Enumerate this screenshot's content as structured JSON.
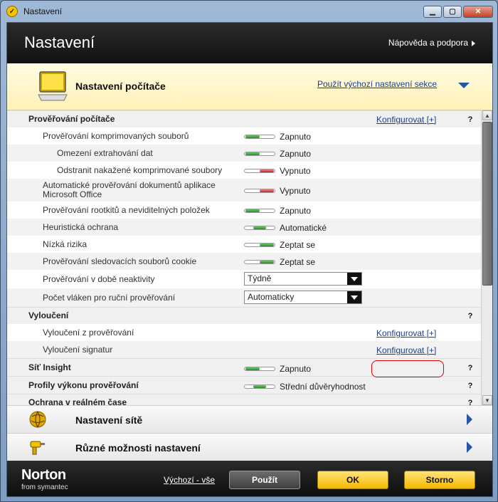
{
  "window": {
    "title": "Nastavení"
  },
  "header": {
    "title": "Nastavení",
    "help_link": "Nápověda a podpora"
  },
  "banner": {
    "title": "Nastavení počítače",
    "reset_link": "Použít výchozí nastavení sekce"
  },
  "groups": {
    "scan": {
      "title": "Prověřování počítače",
      "configure": "Konfigurovat [+]",
      "help": "?"
    },
    "exclusions": {
      "title": "Vyloučení",
      "help": "?"
    },
    "siti": {
      "title": "Síť Insight",
      "state": "Zapnuto",
      "help": "?"
    },
    "profiles": {
      "title": "Profily výkonu prověřování",
      "state": "Střední důvěryhodnost",
      "help": "?"
    },
    "realtime": {
      "title": "Ochrana v reálném čase",
      "help": "?"
    }
  },
  "rows": [
    {
      "label": "Prověřování komprimovaných souborů",
      "state": "Zapnuto",
      "mode": "on"
    },
    {
      "label": "Omezení extrahování dat",
      "state": "Zapnuto",
      "mode": "on"
    },
    {
      "label": "Odstranit nakažené komprimované soubory",
      "state": "Vypnuto",
      "mode": "off"
    },
    {
      "label": "Automatické prověřování dokumentů aplikace Microsoft Office",
      "state": "Vypnuto",
      "mode": "off"
    },
    {
      "label": "Prověřování rootkitů a neviditelných položek",
      "state": "Zapnuto",
      "mode": "on"
    },
    {
      "label": "Heuristická ochrana",
      "state": "Automatické",
      "mode": "mid"
    },
    {
      "label": "Nízká rizika",
      "state": "Zeptat se",
      "mode": "right"
    },
    {
      "label": "Prověřování sledovacích souborů cookie",
      "state": "Zeptat se",
      "mode": "right"
    },
    {
      "label": "Prověřování v době neaktivity",
      "select": "Týdně"
    },
    {
      "label": "Počet vláken pro ruční prověřování",
      "select": "Automaticky"
    }
  ],
  "exclusion_rows": [
    {
      "label": "Vyloučení z prověřování",
      "configure": "Konfigurovat [+]"
    },
    {
      "label": "Vyloučení signatur",
      "configure": "Konfigurovat [+]"
    }
  ],
  "categories": [
    {
      "title": "Nastavení sítě"
    },
    {
      "title": "Různé možnosti nastavení"
    }
  ],
  "footer": {
    "brand": "Norton",
    "brand_sub": "from symantec",
    "defaults_link": "Výchozí - vše",
    "apply": "Použít",
    "ok": "OK",
    "cancel": "Storno"
  }
}
